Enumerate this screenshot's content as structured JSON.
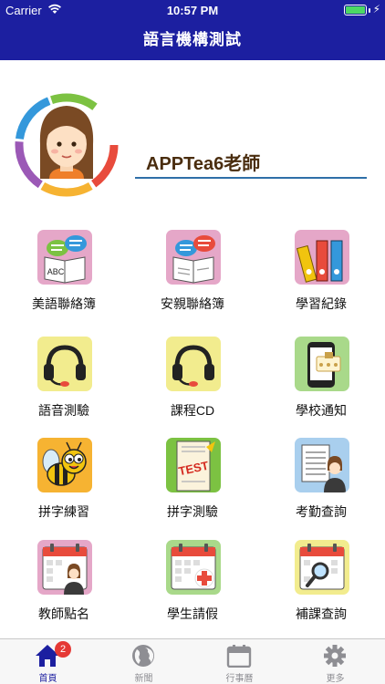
{
  "status_bar": {
    "carrier": "Carrier",
    "time": "10:57 PM",
    "battery_level": 1.0
  },
  "nav": {
    "title": "語言機構測試"
  },
  "profile": {
    "name": "APPTea6老師"
  },
  "menu": [
    {
      "label": "美語聯絡簿",
      "icon": "english-contact-book-icon"
    },
    {
      "label": "安親聯絡簿",
      "icon": "afterschool-contact-book-icon"
    },
    {
      "label": "學習紀錄",
      "icon": "binders-icon"
    },
    {
      "label": "語音測驗",
      "icon": "headset-icon"
    },
    {
      "label": "課程CD",
      "icon": "cd-headset-icon"
    },
    {
      "label": "學校通知",
      "icon": "phone-notice-icon"
    },
    {
      "label": "拼字練習",
      "icon": "bee-icon"
    },
    {
      "label": "拼字測驗",
      "icon": "test-paper-icon"
    },
    {
      "label": "考勤查詢",
      "icon": "attendance-icon"
    },
    {
      "label": "教師點名",
      "icon": "teacher-calendar-icon"
    },
    {
      "label": "學生請假",
      "icon": "leave-calendar-icon"
    },
    {
      "label": "補課查詢",
      "icon": "makeup-search-calendar-icon"
    }
  ],
  "tabs": [
    {
      "label": "首頁",
      "icon": "home-icon",
      "badge": "2",
      "active": true
    },
    {
      "label": "新聞",
      "icon": "globe-icon"
    },
    {
      "label": "行事曆",
      "icon": "calendar-icon"
    },
    {
      "label": "更多",
      "icon": "gear-icon"
    }
  ],
  "colors": {
    "nav": "#1c1fa0",
    "accent_text": "#4a2d0f",
    "underline": "#2f6fa8",
    "badge": "#e53935"
  }
}
